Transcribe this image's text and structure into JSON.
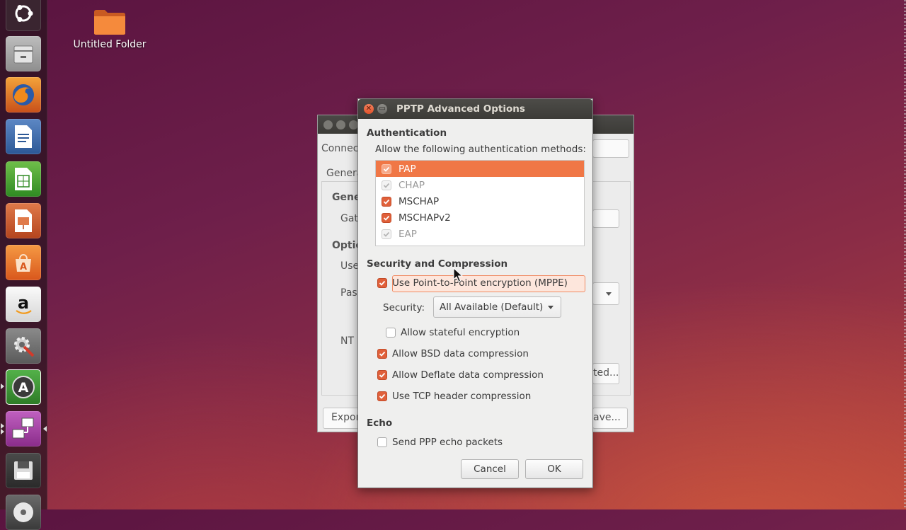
{
  "desktop": {
    "icons": [
      {
        "label": "Untitled Folder",
        "icon": "folder-icon"
      }
    ]
  },
  "launcher": {
    "items": [
      {
        "name": "ubuntu-dash-icon"
      },
      {
        "name": "file-manager-icon"
      },
      {
        "name": "firefox-icon"
      },
      {
        "name": "libreoffice-writer-icon"
      },
      {
        "name": "libreoffice-calc-icon"
      },
      {
        "name": "libreoffice-impress-icon"
      },
      {
        "name": "software-center-icon"
      },
      {
        "name": "amazon-icon"
      },
      {
        "name": "system-settings-icon"
      },
      {
        "name": "software-updater-icon"
      },
      {
        "name": "network-connections-icon"
      },
      {
        "name": "save-disk-icon"
      },
      {
        "name": "dvd-icon"
      }
    ]
  },
  "background_window": {
    "fragments": {
      "connection": "Connect",
      "general_tab": "Genera",
      "general_section": "Gene",
      "gateway": "Gat",
      "optional": "Optic",
      "user": "Use",
      "password": "Pas",
      "nt_domain": "NT D",
      "advanced": "ted...",
      "export": "Expor",
      "save": "ave..."
    }
  },
  "dialog": {
    "title": "PPTP Advanced Options",
    "authentication": {
      "heading": "Authentication",
      "prompt": "Allow the following authentication methods:",
      "methods": [
        {
          "label": "PAP",
          "checked": true,
          "selected": true,
          "sensitive": false
        },
        {
          "label": "CHAP",
          "checked": true,
          "selected": false,
          "sensitive": false
        },
        {
          "label": "MSCHAP",
          "checked": true,
          "selected": false,
          "sensitive": true
        },
        {
          "label": "MSCHAPv2",
          "checked": true,
          "selected": false,
          "sensitive": true
        },
        {
          "label": "EAP",
          "checked": true,
          "selected": false,
          "sensitive": false
        }
      ]
    },
    "security": {
      "heading": "Security and Compression",
      "use_mppe": {
        "label": "Use Point-to-Point encryption (MPPE)",
        "checked": true
      },
      "security_label": "Security:",
      "security_value": "All Available (Default)",
      "stateful": {
        "label": "Allow stateful encryption",
        "checked": false
      },
      "bsd": {
        "label": "Allow BSD data compression",
        "checked": true
      },
      "deflate": {
        "label": "Allow Deflate data compression",
        "checked": true
      },
      "tcp_header": {
        "label": "Use TCP header compression",
        "checked": true
      }
    },
    "echo": {
      "heading": "Echo",
      "send_echo": {
        "label": "Send PPP echo packets",
        "checked": false
      }
    },
    "buttons": {
      "cancel": "Cancel",
      "ok": "OK"
    }
  },
  "colors": {
    "accent": "#f07746",
    "checkbox": "#e0603a",
    "titlebar": "#3c3b37"
  }
}
